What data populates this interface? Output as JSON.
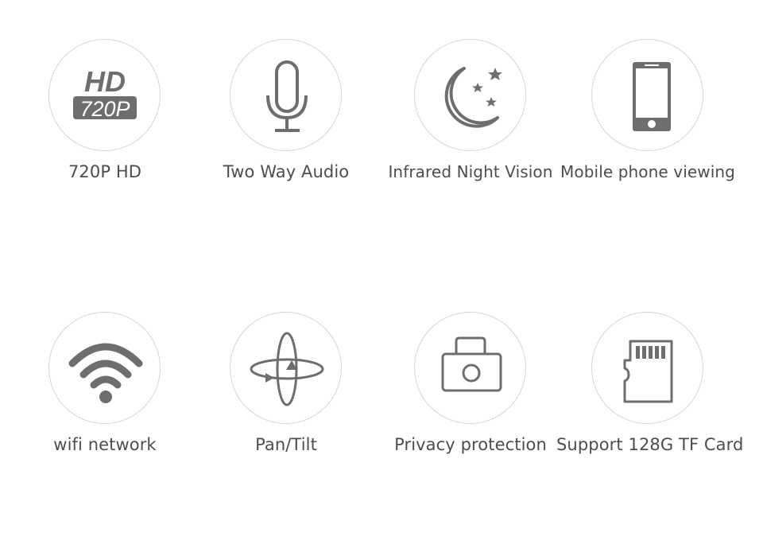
{
  "colors": {
    "icon": "#6e6e6e",
    "circle_border": "#d6d6d6",
    "text": "#4d4d4d",
    "background": "#ffffff"
  },
  "features": [
    {
      "icon": "hd-720p-icon",
      "label": "720P HD",
      "icon_text_top": "HD",
      "icon_text_bottom": "720P"
    },
    {
      "icon": "microphone-icon",
      "label": "Two Way Audio"
    },
    {
      "icon": "moon-stars-icon",
      "label": "Infrared Night Vision"
    },
    {
      "icon": "smartphone-icon",
      "label": "Mobile phone viewing"
    },
    {
      "icon": "wifi-icon",
      "label": "wifi network"
    },
    {
      "icon": "pan-tilt-icon",
      "label": "Pan/Tilt"
    },
    {
      "icon": "privacy-camera-icon",
      "label": "Privacy protection"
    },
    {
      "icon": "sd-card-icon",
      "label": "Support 128G TF Card"
    }
  ]
}
